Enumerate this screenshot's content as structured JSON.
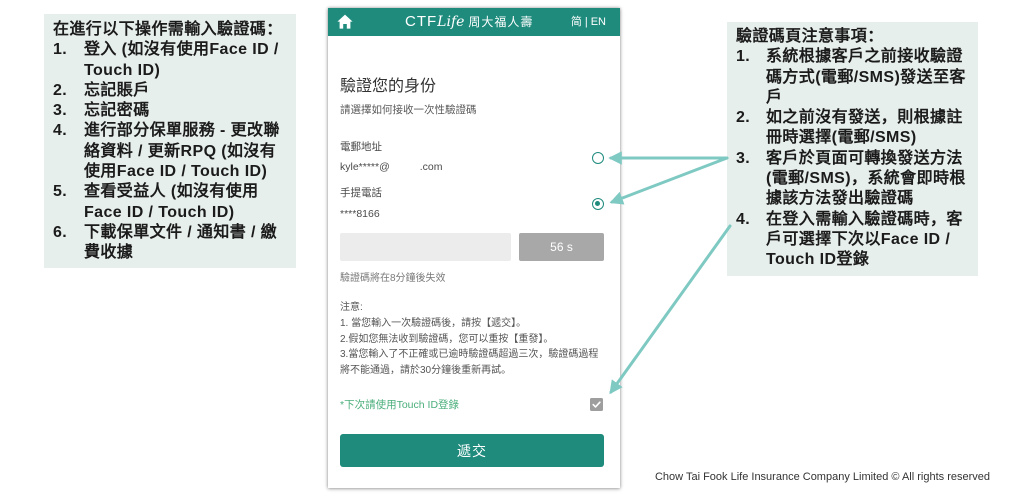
{
  "colors": {
    "brand_teal": "#1f8b7d",
    "touch_id_green": "#4aae7b",
    "note_background": "#e7efec",
    "annotation_arrow": "#7fc9c3",
    "timer_button": "#a8a8a8"
  },
  "left_note": {
    "heading": "在進行以下操作需輸入驗證碼：",
    "items": [
      {
        "num": "1.",
        "text": "登入 (如沒有使用Face ID / Touch ID)"
      },
      {
        "num": "2.",
        "text": "忘記賬戶"
      },
      {
        "num": "3.",
        "text": "忘記密碼"
      },
      {
        "num": "4.",
        "text": "進行部分保單服務 - 更改聯絡資料 / 更新RPQ (如沒有使用Face ID / Touch ID)"
      },
      {
        "num": "5.",
        "text": "查看受益人 (如沒有使用Face ID / Touch ID)"
      },
      {
        "num": "6.",
        "text": "下載保單文件 / 通知書 / 繳費收據"
      }
    ]
  },
  "right_note": {
    "heading": "驗證碼頁注意事項：",
    "items": [
      {
        "num": "1.",
        "text": "系統根據客戶之前接收驗證碼方式(電郵/SMS)發送至客戶"
      },
      {
        "num": "2.",
        "text": "如之前沒有發送，則根據註冊時選擇(電郵/SMS)"
      },
      {
        "num": "3.",
        "text": "客戶於頁面可轉換發送方法(電郵/SMS)，系統會即時根據該方法發出驗證碼"
      },
      {
        "num": "4.",
        "text": "在登入需輸入驗證碼時，客戶可選擇下次以Face ID / Touch ID登錄"
      }
    ]
  },
  "phone": {
    "header": {
      "home_icon": "home-icon",
      "brand_ctf": "CTF",
      "brand_life": "Life",
      "brand_cn": "周大福人壽",
      "lang_sc": "简",
      "lang_divider": "|",
      "lang_en": "EN"
    },
    "form": {
      "title": "驗證您的身份",
      "subtitle": "請選擇如何接收一次性驗證碼",
      "email_option": {
        "label": "電郵地址",
        "value_prefix": "kyle*****@",
        "value_suffix": ".com",
        "selected": false
      },
      "mobile_option": {
        "label": "手提電話",
        "value": "****8166",
        "selected": true
      },
      "otp_input": {
        "value": ""
      },
      "resend_button": {
        "label": "56 s"
      },
      "expiry_note": "驗證碼將在8分鐘後失效",
      "notes": {
        "heading": "注意:",
        "items": [
          "1. 當您輸入一次驗證碼後，請按【遞交】。",
          "2.假如您無法收到驗證碼，您可以重按【重發】。",
          "3.當您輸入了不正確或已逾時驗證碼超過三次，驗證碼過程將不能通過，請於30分鐘後重新再試。"
        ]
      },
      "touch_id_option": {
        "label": "*下次請使用Touch ID登錄",
        "checked": true,
        "check_icon": "check-icon"
      },
      "submit_button": {
        "label": "遞交"
      }
    }
  },
  "footer": {
    "copyright": "Chow Tai Fook Life Insurance Company Limited © All rights reserved"
  }
}
